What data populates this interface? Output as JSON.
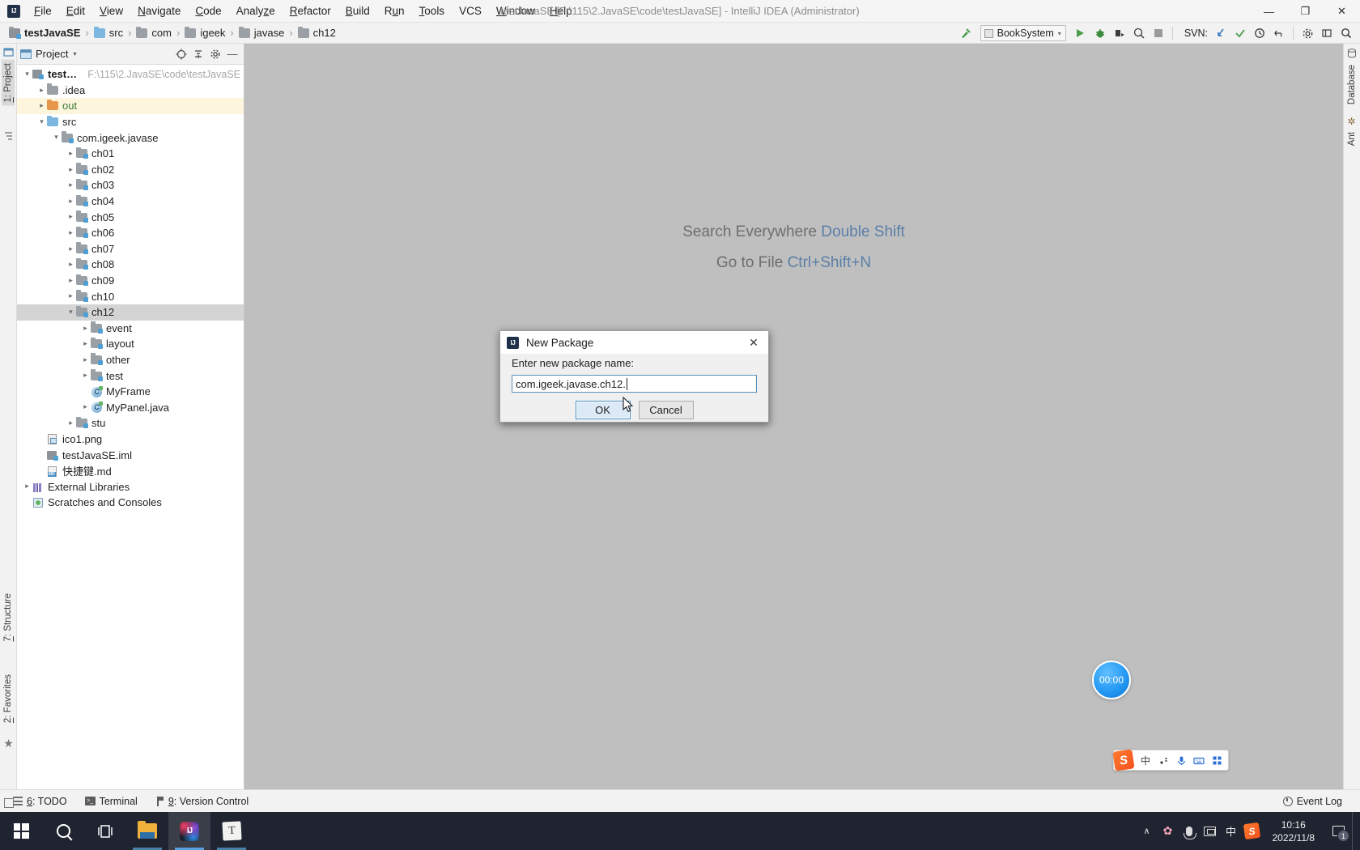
{
  "window": {
    "title": "testJavaSE [F:\\115\\2.JavaSE\\code\\testJavaSE] - IntelliJ IDEA (Administrator)",
    "logo_text": "IJ",
    "minimize": "—",
    "maximize": "❐",
    "close": "✕"
  },
  "menu": [
    {
      "label": "File"
    },
    {
      "label": "Edit"
    },
    {
      "label": "View"
    },
    {
      "label": "Navigate"
    },
    {
      "label": "Code"
    },
    {
      "label": "Analyze"
    },
    {
      "label": "Refactor"
    },
    {
      "label": "Build"
    },
    {
      "label": "Run"
    },
    {
      "label": "Tools"
    },
    {
      "label": "VCS"
    },
    {
      "label": "Window"
    },
    {
      "label": "Help"
    }
  ],
  "breadcrumb": [
    {
      "label": "testJavaSE",
      "icon": "module-icon"
    },
    {
      "label": "src",
      "icon": "source-folder-icon"
    },
    {
      "label": "com",
      "icon": "package-folder-icon"
    },
    {
      "label": "igeek",
      "icon": "package-folder-icon"
    },
    {
      "label": "javase",
      "icon": "package-folder-icon"
    },
    {
      "label": "ch12",
      "icon": "package-folder-icon"
    }
  ],
  "toolbar": {
    "run_config": "BookSystem",
    "chevron": "▾",
    "svn_label": "SVN:",
    "icons": [
      "build-hammer-icon",
      "run-icon",
      "debug-icon",
      "run-coverage-icon",
      "profile-icon",
      "stop-icon",
      "svn-update-icon",
      "svn-commit-icon",
      "svn-history-icon",
      "svn-rollback-icon",
      "settings-icon",
      "layout-icon",
      "search-icon"
    ]
  },
  "project_panel": {
    "title": "Project",
    "chevron": "▾",
    "actions": [
      "target-icon",
      "collapse-all-icon",
      "gear-icon",
      "hide-icon"
    ],
    "tree": [
      {
        "depth": 0,
        "arrow": "down",
        "icon": "module-icon",
        "label": "testJavaSE",
        "bold": true,
        "sub": "F:\\115\\2.JavaSE\\code\\testJavaSE"
      },
      {
        "depth": 1,
        "arrow": "right",
        "icon": "folder-gray",
        "label": ".idea"
      },
      {
        "depth": 1,
        "arrow": "right",
        "icon": "folder-orange",
        "label": "out",
        "highlight": "yellow",
        "green": true
      },
      {
        "depth": 1,
        "arrow": "down",
        "icon": "folder-blue",
        "label": "src"
      },
      {
        "depth": 2,
        "arrow": "down",
        "icon": "package-icon",
        "label": "com.igeek.javase"
      },
      {
        "depth": 3,
        "arrow": "right",
        "icon": "package-icon",
        "label": "ch01"
      },
      {
        "depth": 3,
        "arrow": "right",
        "icon": "package-icon",
        "label": "ch02"
      },
      {
        "depth": 3,
        "arrow": "right",
        "icon": "package-icon",
        "label": "ch03"
      },
      {
        "depth": 3,
        "arrow": "right",
        "icon": "package-icon",
        "label": "ch04"
      },
      {
        "depth": 3,
        "arrow": "right",
        "icon": "package-icon",
        "label": "ch05"
      },
      {
        "depth": 3,
        "arrow": "right",
        "icon": "package-icon",
        "label": "ch06"
      },
      {
        "depth": 3,
        "arrow": "right",
        "icon": "package-icon",
        "label": "ch07"
      },
      {
        "depth": 3,
        "arrow": "right",
        "icon": "package-icon",
        "label": "ch08"
      },
      {
        "depth": 3,
        "arrow": "right",
        "icon": "package-icon",
        "label": "ch09"
      },
      {
        "depth": 3,
        "arrow": "right",
        "icon": "package-icon",
        "label": "ch10"
      },
      {
        "depth": 3,
        "arrow": "down",
        "icon": "package-icon",
        "label": "ch12",
        "selected": true
      },
      {
        "depth": 4,
        "arrow": "right",
        "icon": "package-icon",
        "label": "event"
      },
      {
        "depth": 4,
        "arrow": "right",
        "icon": "package-icon",
        "label": "layout"
      },
      {
        "depth": 4,
        "arrow": "right",
        "icon": "package-icon",
        "label": "other"
      },
      {
        "depth": 4,
        "arrow": "right",
        "icon": "package-icon",
        "label": "test"
      },
      {
        "depth": 4,
        "arrow": "none",
        "icon": "java-class-icon",
        "label": "MyFrame"
      },
      {
        "depth": 4,
        "arrow": "right",
        "icon": "java-class-icon",
        "label": "MyPanel.java"
      },
      {
        "depth": 3,
        "arrow": "right",
        "icon": "package-icon",
        "label": "stu"
      },
      {
        "depth": 1,
        "arrow": "none",
        "icon": "png-file-icon",
        "label": "ico1.png"
      },
      {
        "depth": 1,
        "arrow": "none",
        "icon": "iml-file-icon",
        "label": "testJavaSE.iml"
      },
      {
        "depth": 1,
        "arrow": "none",
        "icon": "md-file-icon",
        "label": "快捷键.md"
      },
      {
        "depth": 0,
        "arrow": "right",
        "icon": "library-icon",
        "label": "External Libraries"
      },
      {
        "depth": 0,
        "arrow": "none",
        "icon": "scratches-icon",
        "label": "Scratches and Consoles"
      }
    ]
  },
  "left_stripe": [
    {
      "label": "1: Project",
      "active": true
    },
    {
      "label": "7: Structure"
    },
    {
      "label": "2: Favorites"
    }
  ],
  "right_stripe": [
    {
      "label": "Database"
    },
    {
      "label": "Ant"
    }
  ],
  "editor": {
    "hints": [
      {
        "text": "Search Everywhere ",
        "key": "Double Shift"
      },
      {
        "text": "Go to File ",
        "key": "Ctrl+Shift+N"
      }
    ]
  },
  "dialog": {
    "title": "New Package",
    "label": "Enter new package name:",
    "input_value": "com.igeek.javase.ch12.",
    "ok_label": "OK",
    "cancel_label": "Cancel",
    "close_glyph": "✕"
  },
  "timer_widget": {
    "value": "00:00"
  },
  "ime_bar": {
    "logo": "S",
    "mode": "中",
    "items": [
      "sogou-logo-icon",
      "chinese-mode-icon",
      "voice-punctuation-icon",
      "microphone-icon",
      "keyboard-icon",
      "toolbox-icon"
    ]
  },
  "bottom_bar": {
    "items": [
      {
        "label": "6: TODO",
        "icon": "todo-icon"
      },
      {
        "label": "Terminal",
        "icon": "terminal-icon"
      },
      {
        "label": "9: Version Control",
        "icon": "version-control-icon"
      }
    ],
    "event_log": "Event Log"
  },
  "taskbar": {
    "apps": [
      {
        "name": "start-button",
        "icon": "windows-logo-icon"
      },
      {
        "name": "search-button",
        "icon": "search-icon"
      },
      {
        "name": "task-view-button",
        "icon": "task-view-icon"
      },
      {
        "name": "file-explorer",
        "icon": "folder-icon"
      },
      {
        "name": "intellij-idea",
        "icon": "intellij-icon"
      },
      {
        "name": "typora",
        "icon": "typora-icon"
      }
    ],
    "tray": {
      "chevron": "∧",
      "icons": [
        "sakura-icon",
        "microphone-icon",
        "display-icon",
        "ime-chinese-icon",
        "sogou-icon"
      ],
      "ime_char": "中",
      "sogou_char": "S",
      "sakura_char": "✿",
      "time": "10:16",
      "date": "2022/11/8",
      "notification_count": "1"
    }
  },
  "colors": {
    "accent_blue": "#5b8fb8",
    "editor_bg": "#bfbfbf",
    "panel_bg": "#f2f2f2",
    "selection": "#d4d4d4",
    "highlight_yellow": "#fdf6dd",
    "taskbar": "#1f2430"
  }
}
